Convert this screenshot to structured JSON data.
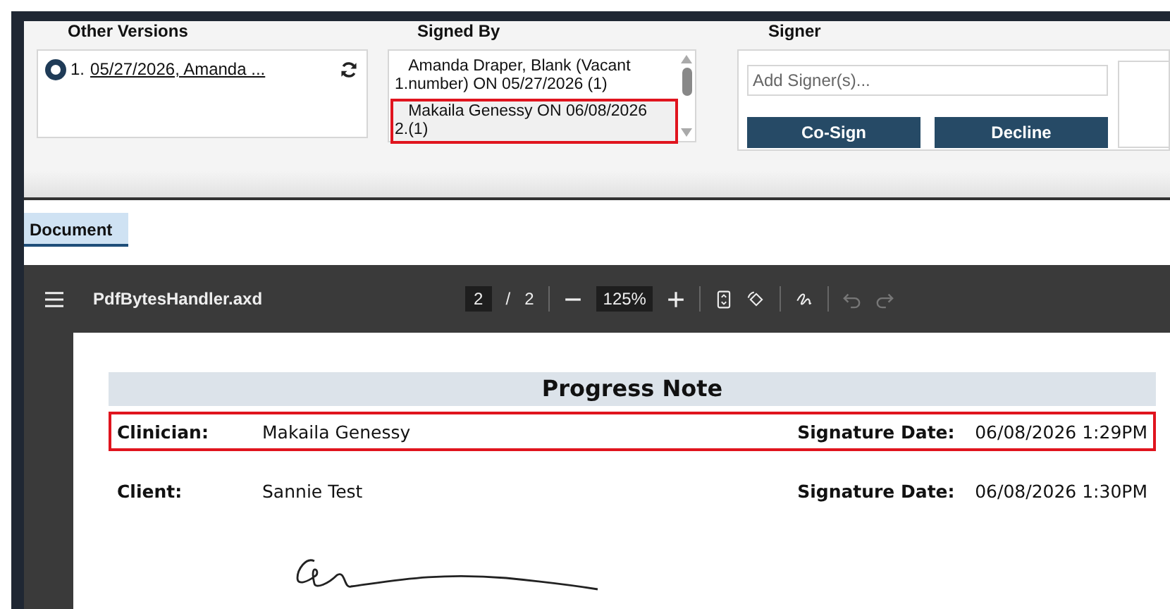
{
  "other_versions": {
    "label": "Other Versions",
    "items": [
      {
        "number": "1.",
        "text": "05/27/2026, Amanda ...",
        "selected": true
      }
    ]
  },
  "signed_by": {
    "label": "Signed By",
    "items": [
      {
        "number": "1.",
        "text": "Amanda Draper, Blank (Vacant number) ON 05/27/2026 (1)",
        "selected": false,
        "highlighted": false
      },
      {
        "number": "2.",
        "text": "Makaila Genessy ON 06/08/2026 (1)",
        "selected": true,
        "highlighted": true
      }
    ]
  },
  "signer": {
    "label": "Signer",
    "placeholder": "Add Signer(s)...",
    "buttons": [
      "Co-Sign",
      "Decline"
    ]
  },
  "tabs": [
    {
      "label": "Document",
      "selected": true
    }
  ],
  "pdf_toolbar": {
    "filename": "PdfBytesHandler.axd",
    "page": "2",
    "page_separator": "/",
    "page_count": "2",
    "zoom": "125%"
  },
  "document": {
    "title": "Progress Note",
    "rows": [
      {
        "label": "Clinician:",
        "value": "Makaila Genessy",
        "date_label": "Signature Date:",
        "date": "06/08/2026 1:29PM",
        "highlighted": true
      },
      {
        "label": "Client:",
        "value": "Sannie Test",
        "date_label": "Signature Date:",
        "date": "06/08/2026 1:30PM",
        "highlighted": false
      }
    ]
  }
}
